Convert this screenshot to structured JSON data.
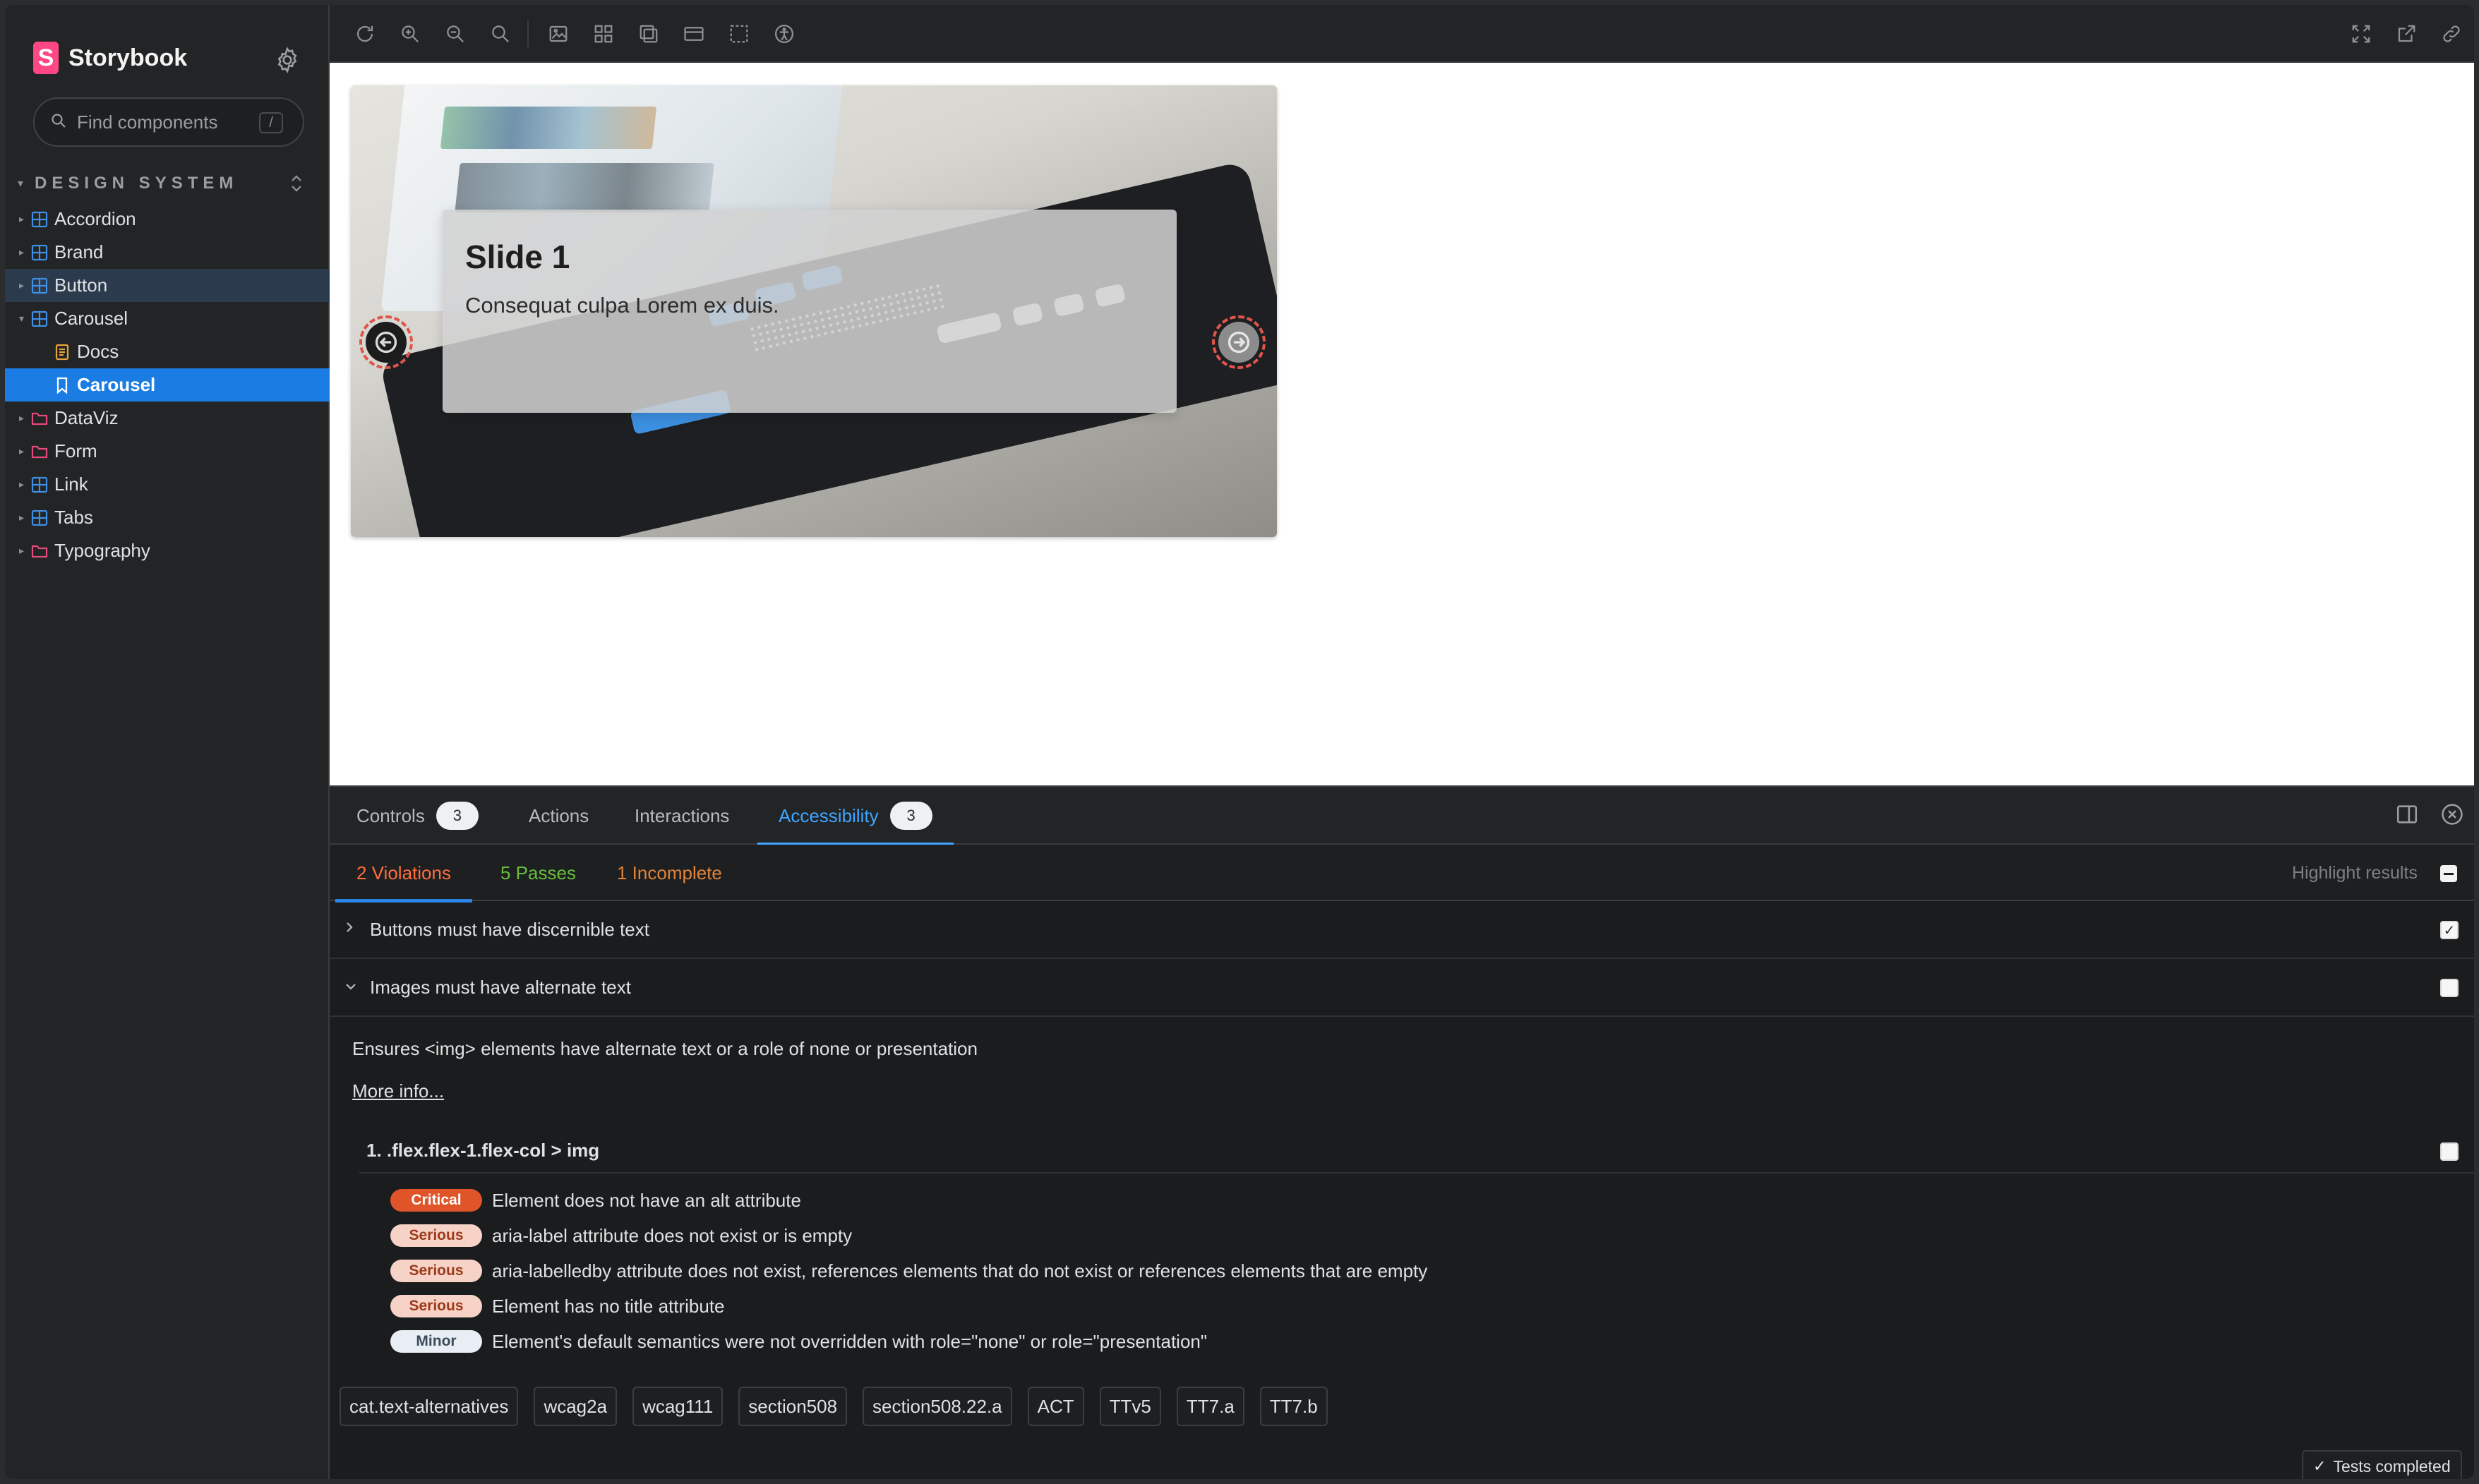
{
  "colors": {
    "accent": "#3fa5ff",
    "brand": "#ff4785",
    "violations": "#ff6e3c",
    "passes": "#66bf3c",
    "incomplete": "#e0843a",
    "critical": "#e0542a"
  },
  "sidebar": {
    "brand": "Storybook",
    "brand_logo_letter": "S",
    "search_placeholder": "Find components",
    "search_shortcut": "/",
    "section_title": "DESIGN SYSTEM",
    "items": [
      {
        "label": "Accordion",
        "icon": "component-icon"
      },
      {
        "label": "Brand",
        "icon": "component-icon"
      },
      {
        "label": "Button",
        "icon": "component-icon"
      },
      {
        "label": "Carousel",
        "icon": "component-icon"
      },
      {
        "label": "Docs",
        "icon": "docs-icon"
      },
      {
        "label": "Carousel",
        "icon": "story-icon"
      },
      {
        "label": "DataViz",
        "icon": "folder-icon"
      },
      {
        "label": "Form",
        "icon": "folder-icon"
      },
      {
        "label": "Link",
        "icon": "component-icon"
      },
      {
        "label": "Tabs",
        "icon": "component-icon"
      },
      {
        "label": "Typography",
        "icon": "folder-icon"
      }
    ]
  },
  "canvas": {
    "slide_title": "Slide 1",
    "slide_text": "Consequat culpa Lorem ex duis."
  },
  "panel": {
    "tabs": [
      {
        "label": "Controls",
        "badge": "3"
      },
      {
        "label": "Actions"
      },
      {
        "label": "Interactions"
      },
      {
        "label": "Accessibility",
        "badge": "3"
      }
    ],
    "subtabs": {
      "violations": "2 Violations",
      "passes": "5 Passes",
      "incomplete": "1 Incomplete"
    },
    "highlight_label": "Highlight results",
    "rules": [
      {
        "title": "Buttons must have discernible text",
        "checked": true
      },
      {
        "title": "Images must have alternate text",
        "checked": false
      }
    ],
    "rule_description": "Ensures <img> elements have alternate text or a role of none or presentation",
    "more_info": "More info...",
    "node_title": "1. .flex.flex-1.flex-col > img",
    "issues": [
      {
        "severity": "Critical",
        "text": "Element does not have an alt attribute"
      },
      {
        "severity": "Serious",
        "text": "aria-label attribute does not exist or is empty"
      },
      {
        "severity": "Serious",
        "text": "aria-labelledby attribute does not exist, references elements that do not exist or references elements that are empty"
      },
      {
        "severity": "Serious",
        "text": "Element has no title attribute"
      },
      {
        "severity": "Minor",
        "text": "Element's default semantics were not overridden with role=\"none\" or role=\"presentation\""
      }
    ],
    "tags": [
      "cat.text-alternatives",
      "wcag2a",
      "wcag111",
      "section508",
      "section508.22.a",
      "ACT",
      "TTv5",
      "TT7.a",
      "TT7.b"
    ],
    "status": "Tests completed"
  }
}
